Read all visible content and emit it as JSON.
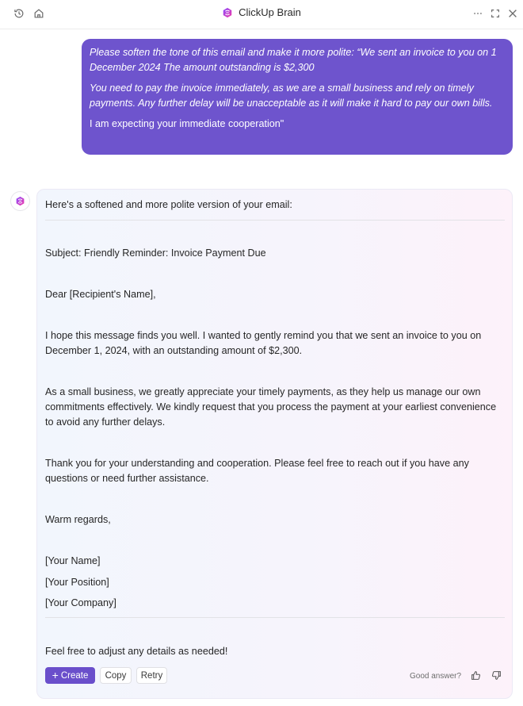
{
  "header": {
    "title": "ClickUp Brain",
    "left_icons": [
      "history-icon",
      "home-icon"
    ],
    "right_icons": [
      "more-icon",
      "expand-icon",
      "close-icon"
    ],
    "brand_color": "#c23ad6"
  },
  "user_message": {
    "paragraphs": [
      "Please soften the tone of this email and make it more polite: “We sent an invoice to you on 1 December 2024 The amount outstanding is $2,300",
      "You need to pay the invoice immediately, as we are a small business and rely on timely payments. Any further delay will be unacceptable as it will make it hard to pay our own bills.",
      "I am expecting your immediate cooperation\""
    ],
    "bubble_color": "#6e54cd"
  },
  "answer": {
    "intro": "Here's a softened and more polite version of your email:",
    "subject": "Subject: Friendly Reminder: Invoice Payment Due",
    "greeting": "Dear [Recipient's Name],",
    "para1": "I hope this message finds you well. I wanted to gently remind you that we sent an invoice to you on December 1, 2024, with an outstanding amount of $2,300.",
    "para2": "As a small business, we greatly appreciate your timely payments, as they help us manage our own commitments effectively. We kindly request that you process the payment at your earliest convenience to avoid any further delays.",
    "para3": "Thank you for your understanding and cooperation. Please feel free to reach out if you have any questions or need further assistance.",
    "closing": "Warm regards,",
    "signature": [
      "[Your Name]",
      "[Your Position]",
      "[Your Company]"
    ],
    "outro": "Feel free to adjust any details as needed!"
  },
  "actions": {
    "create_icon": "+",
    "create_label": "Create",
    "copy_label": "Copy",
    "retry_label": "Retry",
    "feedback_label": "Good answer?",
    "accent_color": "#6a4fcb"
  }
}
